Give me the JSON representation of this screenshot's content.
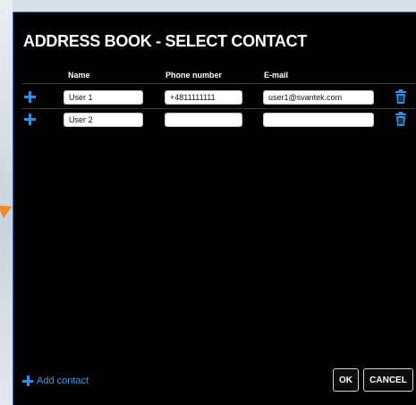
{
  "dialog": {
    "title": "ADDRESS BOOK - SELECT CONTACT",
    "columns": {
      "name": "Name",
      "phone": "Phone number",
      "email": "E-mail"
    },
    "rows": [
      {
        "name": "User 1",
        "phone": "+4811111111",
        "email": "user1@svantek.com"
      },
      {
        "name": "User 2",
        "phone": "",
        "email": ""
      }
    ],
    "add_contact_label": "Add contact",
    "ok_label": "OK",
    "cancel_label": "CANCEL"
  },
  "colors": {
    "accent": "#2f8fe0",
    "dialog_bg": "#000000",
    "background_arrow": "#ef8a2b"
  },
  "icons": [
    "plus-icon",
    "trash-icon"
  ]
}
